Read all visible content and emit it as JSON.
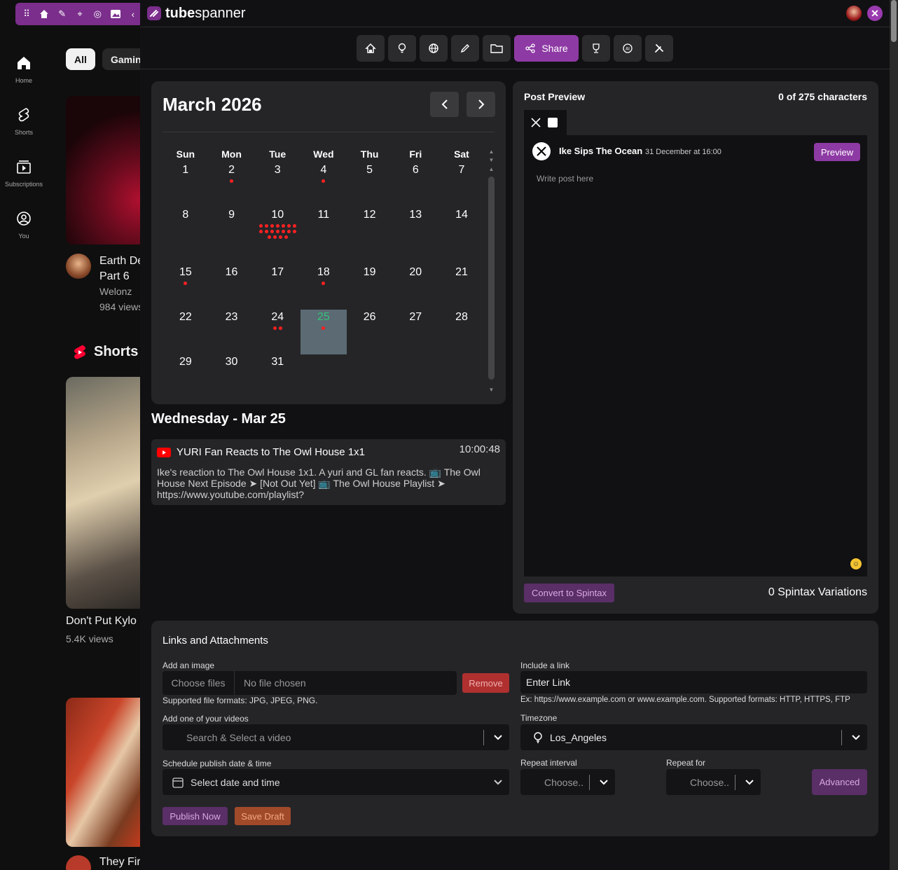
{
  "youtube": {
    "sidebar": [
      {
        "label": "Home",
        "icon": "home-icon"
      },
      {
        "label": "Shorts",
        "icon": "shorts-icon"
      },
      {
        "label": "Subscriptions",
        "icon": "subscriptions-icon"
      },
      {
        "label": "You",
        "icon": "you-icon"
      }
    ],
    "chips": [
      "All",
      "Gamin"
    ],
    "video1": {
      "title_line1": "Earth De",
      "title_line2": "Part 6",
      "channel": "Welonz",
      "views": "984 views"
    },
    "shorts_heading": "Shorts",
    "short1": {
      "title": "Don't Put Kylo i",
      "views": "5.4K views"
    },
    "bottom_title": "They Fir"
  },
  "app": {
    "brand_bold": "tube",
    "brand_regular": "spanner",
    "nav_active_label": "Share",
    "nav_icons": [
      "home-icon",
      "lightbulb-icon",
      "globe-icon",
      "pen-icon",
      "folder-icon",
      "share-icon",
      "trophy-icon",
      "ai-icon",
      "tools-icon"
    ]
  },
  "calendar": {
    "title": "March 2026",
    "weekdays": [
      "Sun",
      "Mon",
      "Tue",
      "Wed",
      "Thu",
      "Fri",
      "Sat"
    ],
    "weeks": [
      [
        {
          "d": "1",
          "dots": 0
        },
        {
          "d": "2",
          "dots": 1
        },
        {
          "d": "3",
          "dots": 0
        },
        {
          "d": "4",
          "dots": 1
        },
        {
          "d": "5",
          "dots": 0
        },
        {
          "d": "6",
          "dots": 0
        },
        {
          "d": "7",
          "dots": 0
        }
      ],
      [
        {
          "d": "8",
          "dots": 0
        },
        {
          "d": "9",
          "dots": 0
        },
        {
          "d": "10",
          "dots": 18
        },
        {
          "d": "11",
          "dots": 0
        },
        {
          "d": "12",
          "dots": 0
        },
        {
          "d": "13",
          "dots": 0
        },
        {
          "d": "14",
          "dots": 0
        }
      ],
      [
        {
          "d": "15",
          "dots": 1
        },
        {
          "d": "16",
          "dots": 0
        },
        {
          "d": "17",
          "dots": 0
        },
        {
          "d": "18",
          "dots": 1
        },
        {
          "d": "19",
          "dots": 0
        },
        {
          "d": "20",
          "dots": 0
        },
        {
          "d": "21",
          "dots": 0
        }
      ],
      [
        {
          "d": "22",
          "dots": 0
        },
        {
          "d": "23",
          "dots": 0
        },
        {
          "d": "24",
          "dots": 2
        },
        {
          "d": "25",
          "dots": 1,
          "selected": true
        },
        {
          "d": "26",
          "dots": 0
        },
        {
          "d": "27",
          "dots": 0
        },
        {
          "d": "28",
          "dots": 0
        }
      ],
      [
        {
          "d": "29",
          "dots": 0
        },
        {
          "d": "30",
          "dots": 0
        },
        {
          "d": "31",
          "dots": 0
        },
        {
          "d": "",
          "dots": 0
        },
        {
          "d": "",
          "dots": 0
        },
        {
          "d": "",
          "dots": 0
        },
        {
          "d": "",
          "dots": 0
        }
      ]
    ],
    "selected_heading": "Wednesday - Mar 25",
    "event": {
      "title": "YURI Fan Reacts to The Owl House 1x1",
      "time": "10:00:48",
      "description": "Ike's reaction to The Owl House 1x1. A yuri and GL fan reacts. 📺 The Owl House Next Episode ➤ [Not Out Yet] 📺 The Owl House Playlist ➤ https://www.youtube.com/playlist?"
    }
  },
  "post_preview": {
    "heading": "Post Preview",
    "char_count": "0 of 275 characters",
    "account": "Ike Sips The Ocean",
    "date": "31 December at 16:00",
    "preview_label": "Preview",
    "placeholder": "Write post here",
    "spintax_button": "Convert to Spintax",
    "spintax_count": "0 Spintax Variations"
  },
  "links": {
    "title": "Links and Attachments",
    "image_label": "Add an image",
    "choose_files": "Choose files",
    "no_file": "No file chosen",
    "remove": "Remove",
    "formats": "Supported file formats: JPG, JPEG, PNG.",
    "link_label": "Include a link",
    "link_placeholder": "Enter Link",
    "link_hint": "Ex: https://www.example.com or www.example.com. Supported formats: HTTP, HTTPS, FTP",
    "videos_label": "Add one of your videos",
    "videos_placeholder": "Search & Select a video",
    "timezone_label": "Timezone",
    "timezone_value": "Los_Angeles",
    "schedule_label": "Schedule publish date & time",
    "schedule_placeholder": "Select date and time",
    "repeat_interval_label": "Repeat interval",
    "repeat_interval_value": "Choose..",
    "repeat_for_label": "Repeat for",
    "repeat_for_value": "Choose..",
    "advanced": "Advanced",
    "publish_now": "Publish Now",
    "save_draft": "Save Draft"
  }
}
